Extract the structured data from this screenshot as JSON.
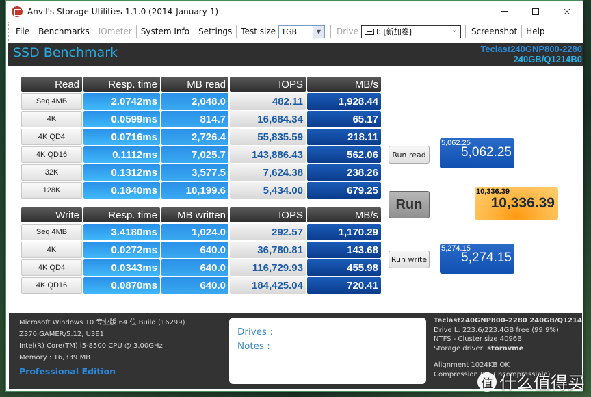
{
  "window": {
    "title": "Anvil's Storage Utilities 1.1.0 (2014-January-1)",
    "controls": {
      "minimize": "minimize",
      "maximize": "maximize",
      "close": "×"
    }
  },
  "menu": {
    "file": "File",
    "benchmarks": "Benchmarks",
    "iometer": "IOmeter",
    "system_info": "System Info",
    "settings": "Settings",
    "test_size_label": "Test size",
    "test_size_value": "1GB",
    "drive_label": "Drive",
    "drive_value": "I: [新加卷]",
    "screenshot": "Screenshot",
    "help": "Help"
  },
  "header": {
    "title": "SSD Benchmark",
    "drive_line1": "Teclast240GNP800-2280",
    "drive_line2": "240GB/Q1214B0"
  },
  "read": {
    "headers": [
      "Read",
      "Resp. time",
      "MB read",
      "IOPS",
      "MB/s"
    ],
    "rows": [
      {
        "test": "Seq 4MB",
        "resp": "2.0742ms",
        "mb": "2,048.0",
        "iops": "482.11",
        "mbs": "1,928.44"
      },
      {
        "test": "4K",
        "resp": "0.0599ms",
        "mb": "814.7",
        "iops": "16,684.34",
        "mbs": "65.17"
      },
      {
        "test": "4K QD4",
        "resp": "0.0716ms",
        "mb": "2,726.4",
        "iops": "55,835.59",
        "mbs": "218.11"
      },
      {
        "test": "4K QD16",
        "resp": "0.1112ms",
        "mb": "7,025.7",
        "iops": "143,886.43",
        "mbs": "562.06"
      },
      {
        "test": "32K",
        "resp": "0.1312ms",
        "mb": "3,577.5",
        "iops": "7,624.38",
        "mbs": "238.26"
      },
      {
        "test": "128K",
        "resp": "0.1840ms",
        "mb": "10,199.6",
        "iops": "5,434.00",
        "mbs": "679.25"
      }
    ]
  },
  "write": {
    "headers": [
      "Write",
      "Resp. time",
      "MB written",
      "IOPS",
      "MB/s"
    ],
    "rows": [
      {
        "test": "Seq 4MB",
        "resp": "3.4180ms",
        "mb": "1,024.0",
        "iops": "292.57",
        "mbs": "1,170.29"
      },
      {
        "test": "4K",
        "resp": "0.0272ms",
        "mb": "640.0",
        "iops": "36,780.81",
        "mbs": "143.68"
      },
      {
        "test": "4K QD4",
        "resp": "0.0343ms",
        "mb": "640.0",
        "iops": "116,729.93",
        "mbs": "455.98"
      },
      {
        "test": "4K QD16",
        "resp": "0.0870ms",
        "mb": "640.0",
        "iops": "184,425.04",
        "mbs": "720.41"
      }
    ]
  },
  "actions": {
    "run_read": "Run read",
    "run": "Run",
    "run_write": "Run write"
  },
  "scores": {
    "read_small": "5,062.25",
    "read_big": "5,062.25",
    "total_small": "10,336.39",
    "total_big": "10,336.39",
    "write_small": "5,274.15",
    "write_big": "5,274.15"
  },
  "system": {
    "os": "Microsoft Windows 10 专业版 64 位 Build (16299)",
    "board": "Z370 GAMER/5.12, U3E1",
    "cpu": "Intel(R) Core(TM) i5-8500 CPU @ 3.00GHz",
    "memory": "Memory : 16,339 MB",
    "edition": "Professional Edition"
  },
  "notes": {
    "drives_label": "Drives :",
    "notes_label": "Notes :"
  },
  "drive_info": {
    "model": "Teclast240GNP800-2280 240GB/Q1214",
    "free": "Drive L: 223.6/223.4GB free (99.9%)",
    "fs": "NTFS - Cluster size 4096B",
    "driver_label": "Storage driver",
    "driver_value": "stornvme",
    "alignment": "Alignment 1024KB OK",
    "compression": "Compression 0% (Incompressible)"
  },
  "watermark": {
    "badge": "值",
    "text": "什么值得买"
  },
  "colors": {
    "accent_blue": "#2aa8e0",
    "header_bg": "#2f2f2f",
    "resp_cell": "#3aa8f0",
    "mbs_cell": "#1050b0",
    "iops_text": "#1a5aa8",
    "total_score": "#ffa830"
  }
}
